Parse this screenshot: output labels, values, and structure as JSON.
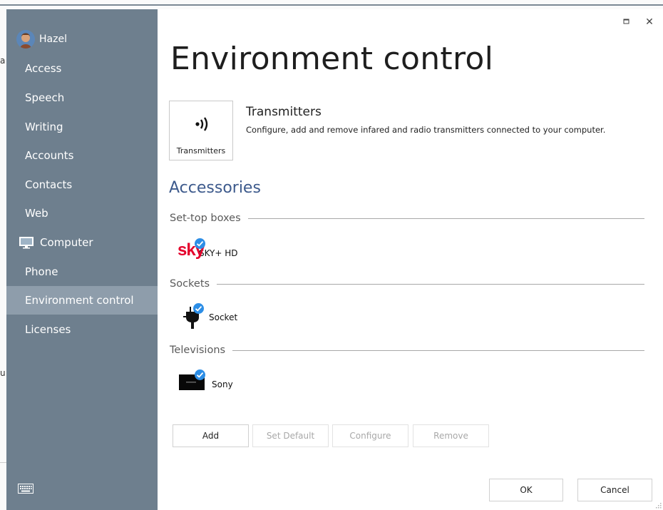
{
  "background": {
    "fragments": [
      "a",
      "u"
    ]
  },
  "window": {
    "maximize_icon": "□",
    "close_icon": "✕"
  },
  "user": {
    "name": "Hazel"
  },
  "sidebar": {
    "items": [
      {
        "label": "Access"
      },
      {
        "label": "Speech"
      },
      {
        "label": "Writing"
      },
      {
        "label": "Accounts"
      },
      {
        "label": "Contacts"
      },
      {
        "label": "Web"
      },
      {
        "label": "Computer",
        "icon": "monitor-icon"
      },
      {
        "label": "Phone"
      },
      {
        "label": "Environment control",
        "selected": true
      },
      {
        "label": "Licenses"
      }
    ],
    "footer_icon": "keyboard-icon"
  },
  "main": {
    "title": "Environment control",
    "transmitters": {
      "tile_label": "Transmitters",
      "heading": "Transmitters",
      "description": "Configure, add and remove infared and radio transmitters connected to your computer."
    },
    "accessories_title": "Accessories",
    "groups": [
      {
        "label": "Set-top boxes",
        "items": [
          {
            "label": "SKY+ HD",
            "logo_text": "sky",
            "icon": "sky-logo-icon"
          }
        ]
      },
      {
        "label": "Sockets",
        "items": [
          {
            "label": "Socket",
            "icon": "plug-icon"
          }
        ]
      },
      {
        "label": "Televisions",
        "items": [
          {
            "label": "Sony",
            "icon": "tv-icon"
          }
        ]
      }
    ],
    "actions": {
      "add": "Add",
      "set_default": "Set Default",
      "configure": "Configure",
      "remove": "Remove"
    },
    "dialog": {
      "ok": "OK",
      "cancel": "Cancel"
    }
  },
  "colors": {
    "sidebar_bg": "#6e7f8e",
    "sidebar_selected": "#8e9dab",
    "accent_heading": "#3d5a8c",
    "check_badge": "#2d8ee6",
    "sky_red": "#e4002b"
  }
}
